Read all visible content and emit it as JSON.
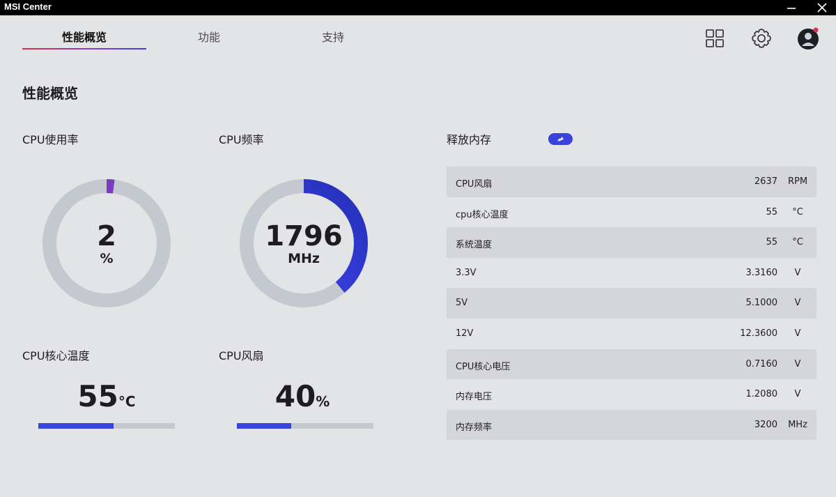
{
  "window": {
    "title": "MSI Center"
  },
  "tabs": [
    {
      "label": "性能概览"
    },
    {
      "label": "功能"
    },
    {
      "label": "支持"
    }
  ],
  "page_title": "性能概览",
  "cpu_usage": {
    "label": "CPU使用率",
    "value": "2",
    "unit": "%",
    "fraction": 0.02
  },
  "cpu_freq": {
    "label": "CPU频率",
    "value": "1796",
    "unit": "MHz",
    "fraction": 0.39
  },
  "cpu_temp": {
    "label": "CPU核心温度",
    "value": "55",
    "unit": "°C",
    "fraction": 0.55
  },
  "cpu_fan": {
    "label": "CPU风扇",
    "value": "40",
    "unit": "%",
    "fraction": 0.4
  },
  "release_memory": {
    "label": "释放内存"
  },
  "sensors": [
    {
      "name": "CPU风扇",
      "value": "2637",
      "unit": "RPM"
    },
    {
      "name": "cpu核心温度",
      "value": "55",
      "unit": "°C"
    },
    {
      "name": "系统温度",
      "value": "55",
      "unit": "°C"
    },
    {
      "name": "3.3V",
      "value": "3.3160",
      "unit": "V"
    },
    {
      "name": "5V",
      "value": "5.1000",
      "unit": "V"
    },
    {
      "name": "12V",
      "value": "12.3600",
      "unit": "V"
    },
    {
      "name": "CPU核心电压",
      "value": "0.7160",
      "unit": "V"
    },
    {
      "name": "内存电压",
      "value": "1.2080",
      "unit": "V"
    },
    {
      "name": "内存频率",
      "value": "3200",
      "unit": "MHz"
    }
  ],
  "colors": {
    "accent": "#3743dc",
    "gauge_track": "#c4c8cf",
    "notification_dot": "#e0304a"
  }
}
